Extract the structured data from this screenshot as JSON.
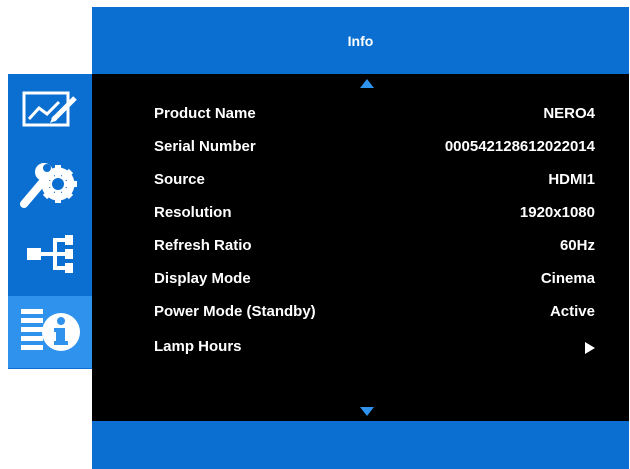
{
  "header": {
    "title": "Info"
  },
  "sidebar": {
    "items": [
      {
        "icon": "picture-edit-icon",
        "active": false
      },
      {
        "icon": "setup-tools-icon",
        "active": false
      },
      {
        "icon": "connection-icon",
        "active": false
      },
      {
        "icon": "info-icon",
        "active": true
      }
    ]
  },
  "info": {
    "rows": [
      {
        "label": "Product Name",
        "value": "NERO4"
      },
      {
        "label": "Serial Number",
        "value": "000542128612022014"
      },
      {
        "label": "Source",
        "value": "HDMI1"
      },
      {
        "label": "Resolution",
        "value": "1920x1080"
      },
      {
        "label": "Refresh Ratio",
        "value": "60Hz"
      },
      {
        "label": "Display Mode",
        "value": "Cinema"
      },
      {
        "label": "Power Mode (Standby)",
        "value": "Active"
      },
      {
        "label": "Lamp Hours",
        "value": ""
      }
    ]
  },
  "colors": {
    "menu_blue": "#0a6fd0",
    "active_blue": "#2f93ee",
    "panel": "#000000",
    "text": "#ffffff"
  }
}
